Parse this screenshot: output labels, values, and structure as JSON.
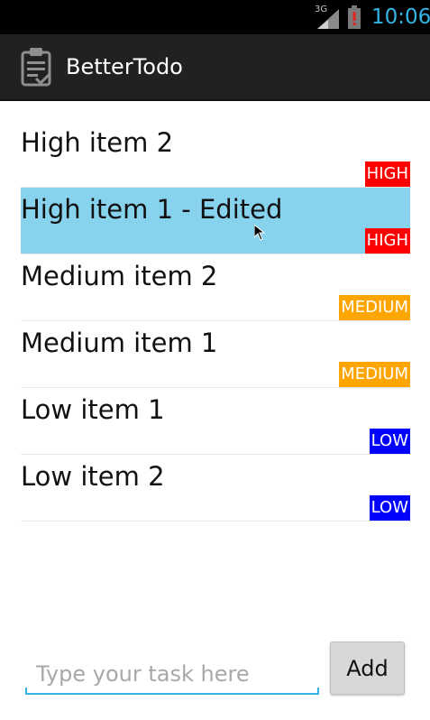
{
  "status_bar": {
    "network": "3G",
    "time": "10:06",
    "clock_color": "#33b5e5",
    "icons": [
      "signal-icon",
      "battery-alert-icon"
    ]
  },
  "action_bar": {
    "icon": "clipboard-icon",
    "title": "BetterTodo"
  },
  "tasks": [
    {
      "text": "High item 2",
      "priority": "HIGH",
      "color": "#ff0000",
      "selected": false
    },
    {
      "text": "High item 1 - Edited",
      "priority": "HIGH",
      "color": "#ff0000",
      "selected": true
    },
    {
      "text": "Medium item 2",
      "priority": "MEDIUM",
      "color": "#ffa500",
      "selected": false
    },
    {
      "text": "Medium item 1",
      "priority": "MEDIUM",
      "color": "#ffa500",
      "selected": false
    },
    {
      "text": "Low item 1",
      "priority": "LOW",
      "color": "#0000ff",
      "selected": false
    },
    {
      "text": "Low item 2",
      "priority": "LOW",
      "color": "#0000ff",
      "selected": false
    }
  ],
  "selection_color": "#87d3ee",
  "task_input": {
    "placeholder": "Type your task here",
    "value": ""
  },
  "add_button": {
    "label": "Add"
  }
}
